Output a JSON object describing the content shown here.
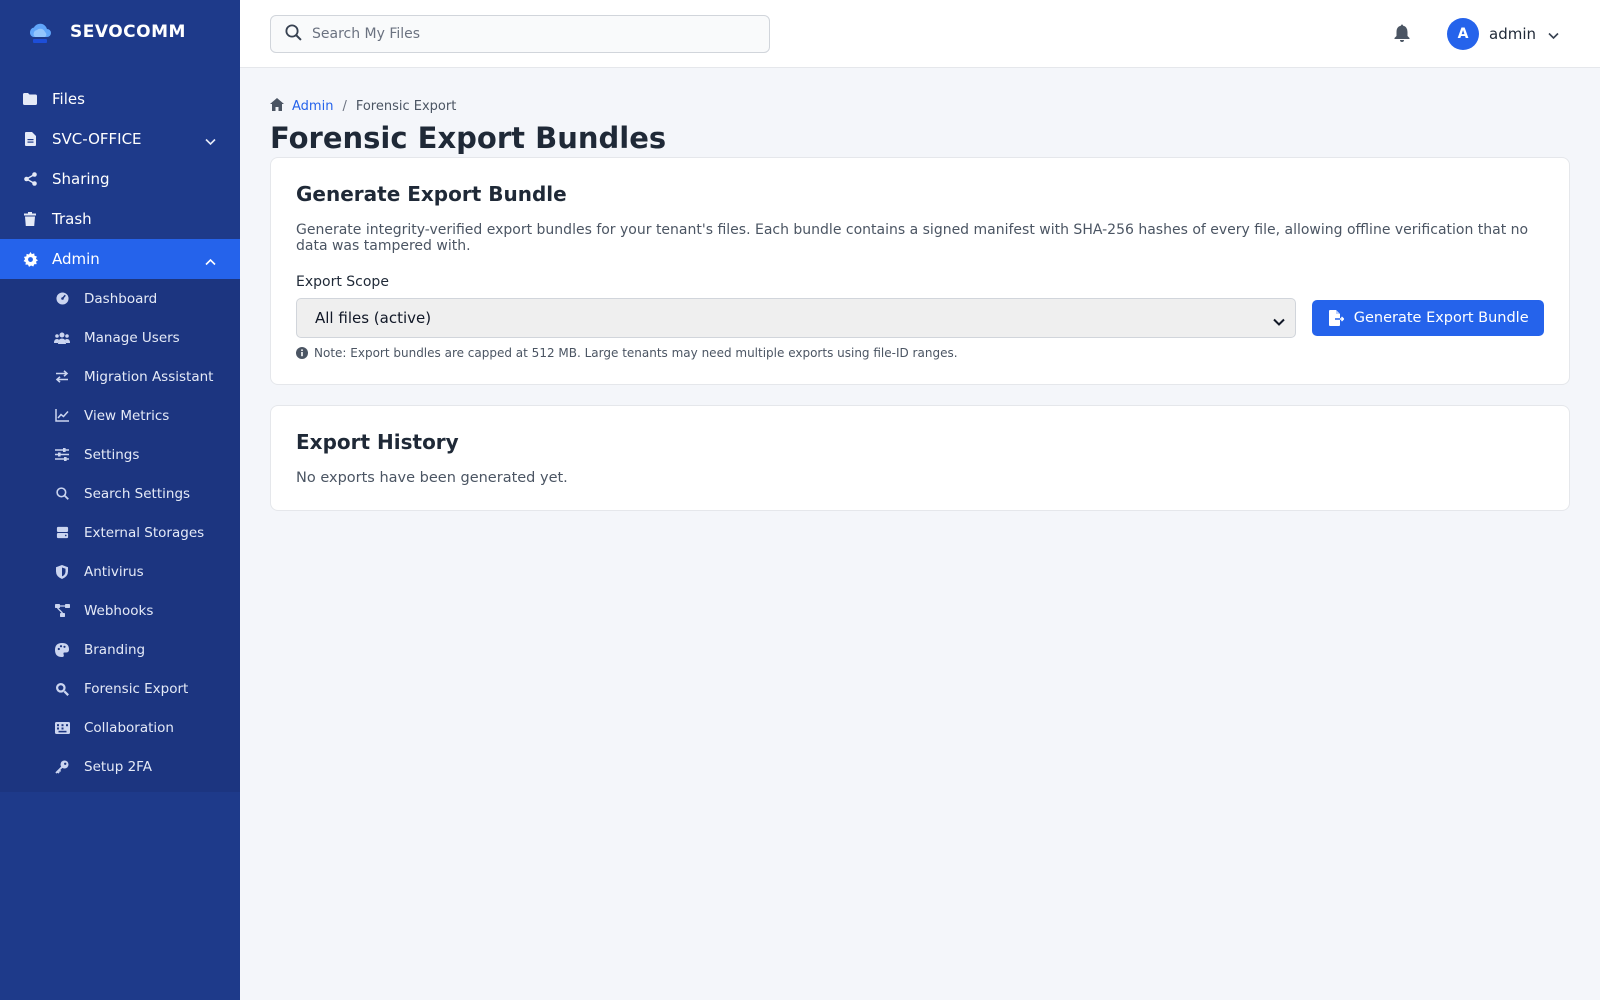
{
  "app": {
    "name": "SEVOCOMM"
  },
  "sidebar": {
    "items": [
      {
        "label": "Files",
        "icon": "folder-icon"
      },
      {
        "label": "SVC-OFFICE",
        "icon": "document-icon"
      },
      {
        "label": "Sharing",
        "icon": "share-icon"
      },
      {
        "label": "Trash",
        "icon": "trash-icon"
      },
      {
        "label": "Admin",
        "icon": "gear-icon",
        "active": true
      }
    ],
    "admin_items": [
      {
        "label": "Dashboard",
        "icon": "gauge-icon"
      },
      {
        "label": "Manage Users",
        "icon": "users-icon"
      },
      {
        "label": "Migration Assistant",
        "icon": "arrows-exchange-icon"
      },
      {
        "label": "View Metrics",
        "icon": "chart-line-icon"
      },
      {
        "label": "Settings",
        "icon": "sliders-icon"
      },
      {
        "label": "Search Settings",
        "icon": "search-icon"
      },
      {
        "label": "External Storages",
        "icon": "hard-drive-icon"
      },
      {
        "label": "Antivirus",
        "icon": "shield-icon"
      },
      {
        "label": "Webhooks",
        "icon": "network-icon"
      },
      {
        "label": "Branding",
        "icon": "palette-icon"
      },
      {
        "label": "Forensic Export",
        "icon": "magnify-search-icon"
      },
      {
        "label": "Collaboration",
        "icon": "keyboard-icon"
      },
      {
        "label": "Setup 2FA",
        "icon": "key-icon"
      }
    ]
  },
  "topbar": {
    "search_placeholder": "Search My Files",
    "user_initial": "A",
    "user_name": "admin"
  },
  "breadcrumb": {
    "parent": "Admin",
    "separator": "/",
    "current": "Forensic Export"
  },
  "page_title": "Forensic Export Bundles",
  "generate_card": {
    "title": "Generate Export Bundle",
    "description": "Generate integrity-verified export bundles for your tenant's files. Each bundle contains a signed manifest with SHA-256 hashes of every file, allowing offline verification that no data was tampered with.",
    "scope_label": "Export Scope",
    "scope_selected": "All files (active)",
    "button_label": "Generate Export Bundle",
    "note": "Note: Export bundles are capped at 512 MB. Large tenants may need multiple exports using file-ID ranges."
  },
  "history_card": {
    "title": "Export History",
    "empty_text": "No exports have been generated yet."
  },
  "colors": {
    "sidebar_bg": "#1e3a8a",
    "active_item": "#2563eb",
    "accent": "#2563eb",
    "page_bg": "#f4f6fa"
  }
}
